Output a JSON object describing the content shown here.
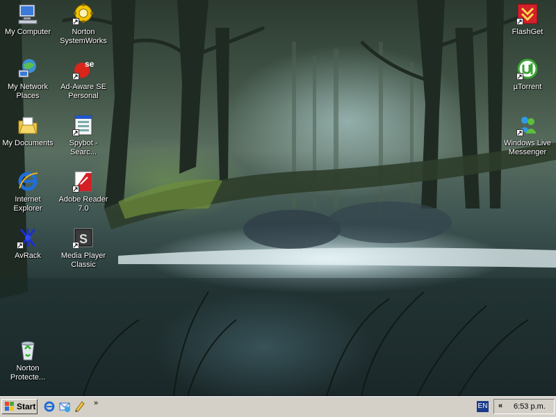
{
  "desktop": {
    "left_icons": [
      {
        "label": "My Computer",
        "icon": "my-computer-icon"
      },
      {
        "label": "My Network Places",
        "icon": "network-places-icon"
      },
      {
        "label": "My Documents",
        "icon": "my-documents-icon"
      },
      {
        "label": "Internet Explorer",
        "icon": "internet-explorer-icon"
      },
      {
        "label": "AvRack",
        "icon": "avrack-icon"
      }
    ],
    "second_icons": [
      {
        "label": "Norton SystemWorks",
        "icon": "norton-systemworks-icon"
      },
      {
        "label": "Ad-Aware SE Personal",
        "icon": "ad-aware-icon"
      },
      {
        "label": "Spybot - Searc...",
        "icon": "spybot-icon"
      },
      {
        "label": "Adobe Reader 7.0",
        "icon": "adobe-reader-icon"
      },
      {
        "label": "Media Player Classic",
        "icon": "media-player-classic-icon"
      }
    ],
    "right_icons": [
      {
        "label": "FlashGet",
        "icon": "flashget-icon"
      },
      {
        "label": "µTorrent",
        "icon": "utorrent-icon"
      },
      {
        "label": "Windows Live Messenger",
        "icon": "messenger-icon"
      }
    ],
    "bottom_icon": {
      "label": "Norton Protecte...",
      "icon": "recycle-bin-icon"
    }
  },
  "taskbar": {
    "start_label": "Start",
    "quick_launch": [
      "internet-explorer-icon",
      "outlook-express-icon",
      "show-desktop-icon"
    ],
    "quick_launch_more": "»",
    "language": "EN",
    "tray_expand": "«",
    "clock": "6:53 p.m."
  }
}
